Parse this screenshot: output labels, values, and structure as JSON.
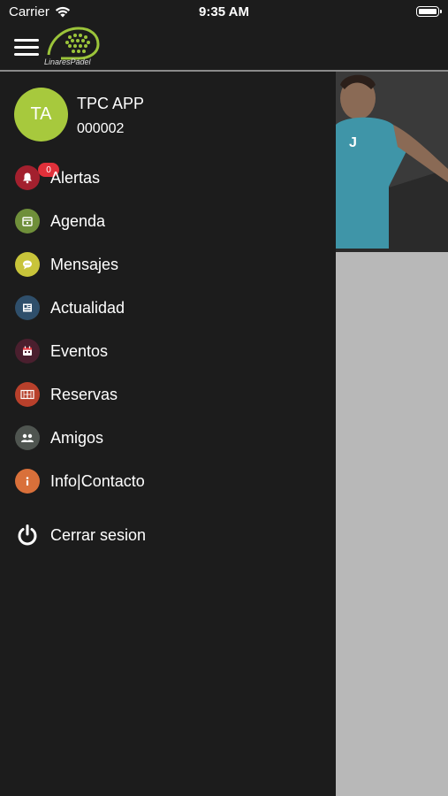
{
  "status_bar": {
    "carrier": "Carrier",
    "time": "9:35 AM"
  },
  "header": {
    "logo_text": "LinaresPádel"
  },
  "user": {
    "initials": "TA",
    "name": "TPC APP",
    "id": "000002"
  },
  "menu": [
    {
      "label": "Alertas",
      "icon": "bell-icon",
      "color": "#a3202e",
      "badge": "0"
    },
    {
      "label": "Agenda",
      "icon": "calendar-icon",
      "color": "#6f8f3a"
    },
    {
      "label": "Mensajes",
      "icon": "chat-icon",
      "color": "#c8c43a"
    },
    {
      "label": "Actualidad",
      "icon": "news-icon",
      "color": "#2f4f6b"
    },
    {
      "label": "Eventos",
      "icon": "events-calendar-icon",
      "color": "#4a1f2e"
    },
    {
      "label": "Reservas",
      "icon": "court-icon",
      "color": "#b8402b"
    },
    {
      "label": "Amigos",
      "icon": "friends-icon",
      "color": "#4f5550"
    },
    {
      "label": "Info|Contacto",
      "icon": "info-icon",
      "color": "#d9703a"
    }
  ],
  "logout": {
    "label": "Cerrar sesion",
    "icon": "power-icon"
  },
  "colors": {
    "avatar": "#a7c93d",
    "badge": "#e0303a",
    "drawer_bg": "#1c1c1c"
  }
}
